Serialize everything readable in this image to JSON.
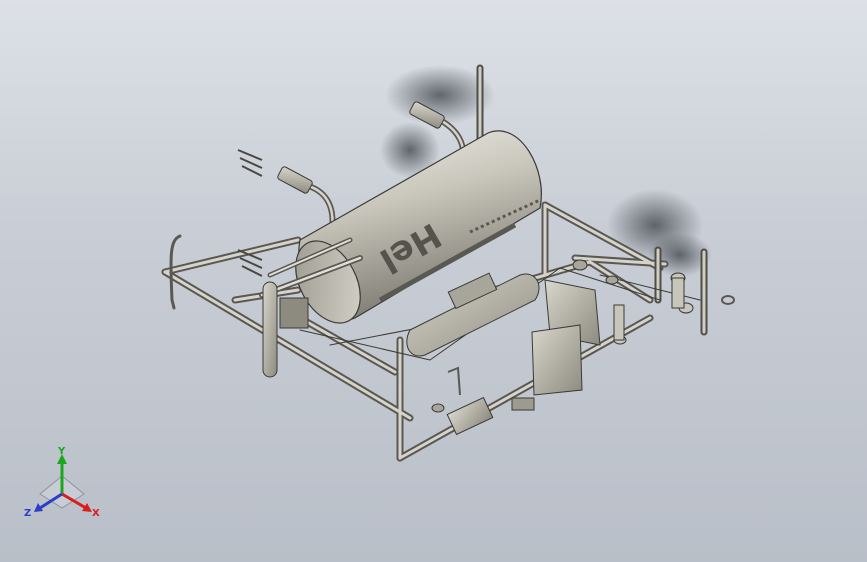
{
  "model": {
    "drum_text": "Hel",
    "colors": {
      "background_top": "#dde1e7",
      "background_bottom": "#b9bfc8",
      "metal_light": "#e8e6dc",
      "metal_mid": "#b3b1a6",
      "metal_dark": "#6c6a61",
      "edge": "#3a3a36"
    }
  },
  "triad": {
    "x_label": "X",
    "y_label": "Y",
    "z_label": "Z",
    "x_color": "#d91e1e",
    "y_color": "#1ea51e",
    "z_color": "#2a3ec8"
  }
}
